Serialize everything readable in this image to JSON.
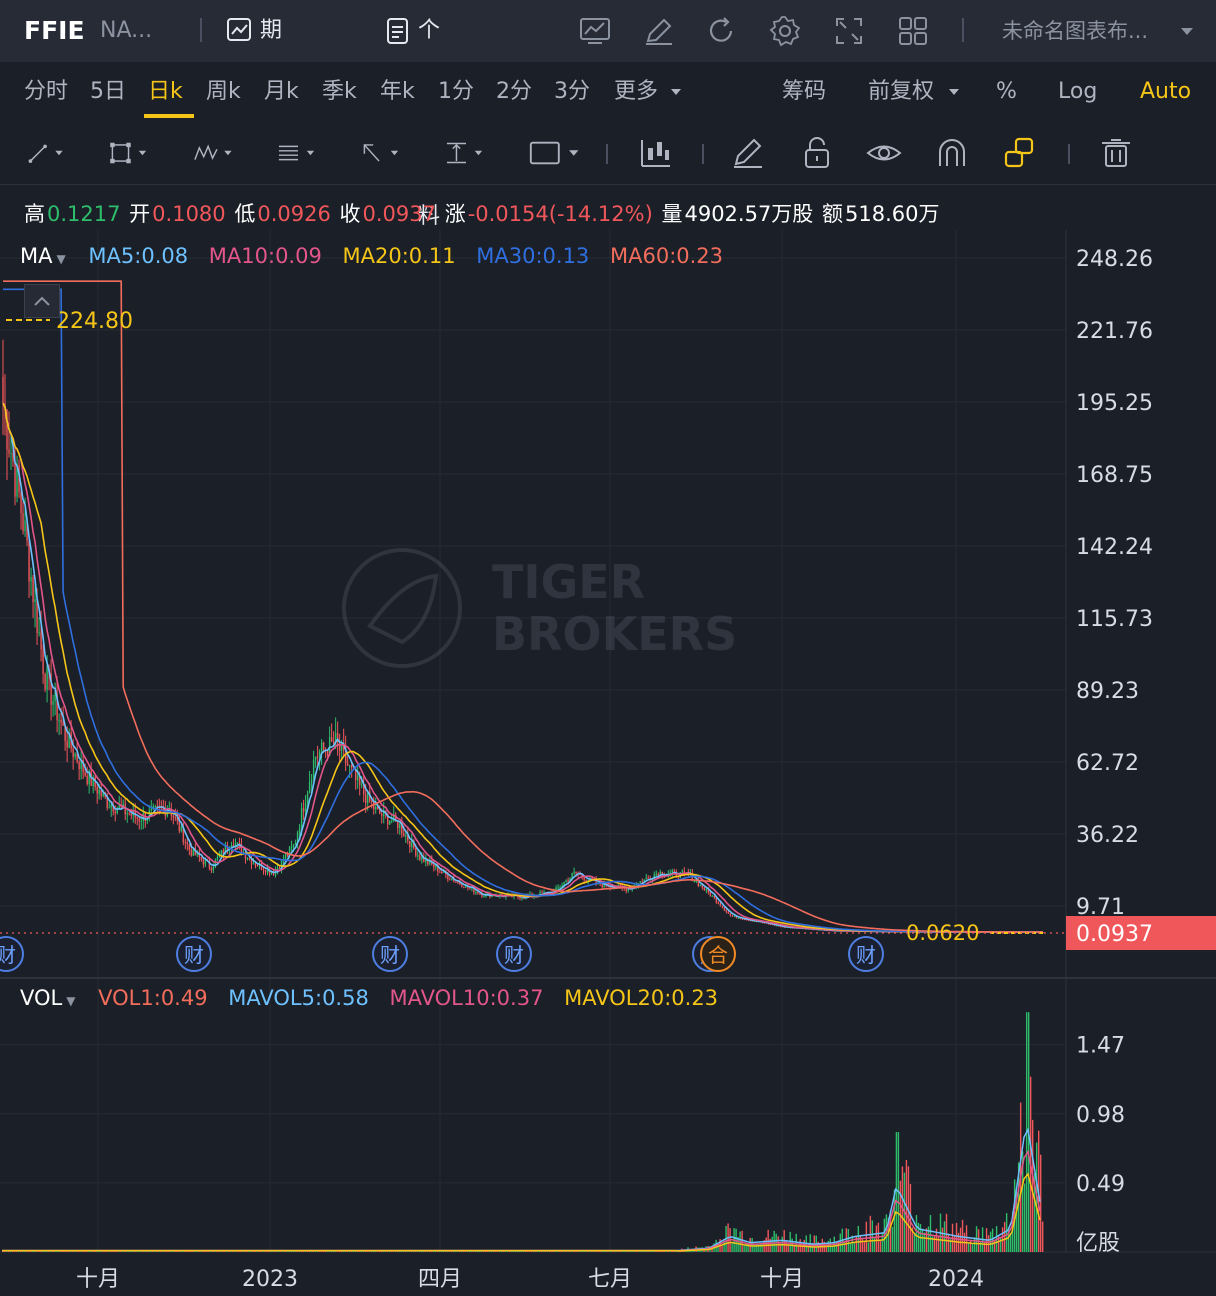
{
  "header": {
    "symbol": "FFIE",
    "name": "NA...",
    "options_chain": "期权链",
    "stock_profile": "个股资料",
    "layout_name": "未命名图表布..."
  },
  "periods": {
    "items": [
      "分时",
      "5日",
      "日k",
      "周k",
      "月k",
      "季k",
      "年k",
      "1分",
      "2分",
      "3分",
      "更多"
    ],
    "active": "日k",
    "chips": "筹码",
    "adjust": "前复权",
    "percent": "%",
    "log": "Log",
    "auto": "Auto"
  },
  "tools": [
    "line-tool-icon",
    "rect-tool-icon",
    "pattern-tool-icon",
    "fib-tool-icon",
    "arrow-tool-icon",
    "measure-tool-icon",
    "text-tool-icon",
    "candle-tool-icon",
    "pencil-icon",
    "unlock-icon",
    "eye-icon",
    "magnet-icon",
    "link-layers-icon",
    "trash-icon"
  ],
  "quote": {
    "high_label": "高",
    "high": "0.1217",
    "open_label": "开",
    "open": "0.1080",
    "low_label": "低",
    "low": "0.0926",
    "close_label": "收",
    "close": "0.0937",
    "change_label": "涨",
    "change": "-0.0154(-14.12%)",
    "volume_label": "量",
    "volume": "4902.57万股",
    "amount_label": "额",
    "amount": "518.60万"
  },
  "ma_legend": {
    "label": "MA",
    "items": [
      {
        "text": "MA5:0.08",
        "color": "#6ec1ff"
      },
      {
        "text": "MA10:0.09",
        "color": "#e3568a"
      },
      {
        "text": "MA20:0.11",
        "color": "#f5c518"
      },
      {
        "text": "MA30:0.13",
        "color": "#2f6fe0"
      },
      {
        "text": "MA60:0.23",
        "color": "#f26d5b"
      }
    ]
  },
  "vol_legend": {
    "label": "VOL",
    "items": [
      {
        "text": "VOL1:0.49",
        "color": "#f26d5b"
      },
      {
        "text": "MAVOL5:0.58",
        "color": "#6ec1ff"
      },
      {
        "text": "MAVOL10:0.37",
        "color": "#e3568a"
      },
      {
        "text": "MAVOL20:0.23",
        "color": "#f5c518"
      }
    ]
  },
  "watermark": {
    "line1": "TIGER",
    "line2": "BROKERS"
  },
  "chart_data": [
    {
      "type": "candlestick",
      "y_ticks": [
        "248.26",
        "221.76",
        "195.25",
        "168.75",
        "142.24",
        "115.73",
        "89.23",
        "62.72",
        "36.22",
        "9.71"
      ],
      "x_ticks": [
        "十月",
        "2023",
        "四月",
        "七月",
        "十月",
        "2024"
      ],
      "max_marker": "224.80",
      "min_marker": "0.0620",
      "last_price": "0.0937",
      "event_markers": [
        "财",
        "财",
        "财",
        "财",
        "财",
        "合",
        "财"
      ],
      "series": [
        {
          "name": "MA5",
          "color": "#6ec1ff",
          "values": [
            0.08
          ]
        },
        {
          "name": "MA10",
          "color": "#e3568a",
          "values": [
            0.09
          ]
        },
        {
          "name": "MA20",
          "color": "#f5c518",
          "values": [
            0.11
          ]
        },
        {
          "name": "MA30",
          "color": "#2f6fe0",
          "values": [
            0.13
          ]
        },
        {
          "name": "MA60",
          "color": "#f26d5b",
          "values": [
            0.23
          ]
        }
      ],
      "close_trend": [
        [
          0,
          195
        ],
        [
          0.02,
          150
        ],
        [
          0.04,
          95
        ],
        [
          0.06,
          72
        ],
        [
          0.08,
          58
        ],
        [
          0.1,
          48
        ],
        [
          0.13,
          42
        ],
        [
          0.16,
          46
        ],
        [
          0.18,
          30
        ],
        [
          0.2,
          24
        ],
        [
          0.22,
          34
        ],
        [
          0.24,
          26
        ],
        [
          0.26,
          22
        ],
        [
          0.28,
          32
        ],
        [
          0.3,
          65
        ],
        [
          0.32,
          70
        ],
        [
          0.34,
          55
        ],
        [
          0.36,
          44
        ],
        [
          0.38,
          40
        ],
        [
          0.4,
          28
        ],
        [
          0.43,
          20
        ],
        [
          0.46,
          14
        ],
        [
          0.5,
          13
        ],
        [
          0.53,
          15
        ],
        [
          0.55,
          22
        ],
        [
          0.57,
          18
        ],
        [
          0.6,
          16
        ],
        [
          0.63,
          22
        ],
        [
          0.66,
          21
        ],
        [
          0.68,
          14
        ],
        [
          0.7,
          6
        ],
        [
          0.75,
          2
        ],
        [
          0.8,
          0.6
        ],
        [
          0.85,
          0.3
        ],
        [
          0.9,
          0.15
        ],
        [
          1,
          0.0937
        ]
      ]
    },
    {
      "type": "bar",
      "name": "VOL",
      "y_ticks": [
        "1.47",
        "0.98",
        "0.49"
      ],
      "unit": "亿股",
      "x_ticks": [
        "十月",
        "2023",
        "四月",
        "七月",
        "十月",
        "2024"
      ],
      "volume_trend": [
        [
          0,
          0.01
        ],
        [
          0.5,
          0.01
        ],
        [
          0.65,
          0.02
        ],
        [
          0.68,
          0.05
        ],
        [
          0.7,
          0.2
        ],
        [
          0.72,
          0.12
        ],
        [
          0.75,
          0.15
        ],
        [
          0.78,
          0.1
        ],
        [
          0.8,
          0.12
        ],
        [
          0.82,
          0.2
        ],
        [
          0.85,
          0.25
        ],
        [
          0.86,
          0.85
        ],
        [
          0.88,
          0.3
        ],
        [
          0.9,
          0.25
        ],
        [
          0.92,
          0.2
        ],
        [
          0.95,
          0.15
        ],
        [
          0.97,
          0.3
        ],
        [
          0.985,
          1.7
        ],
        [
          1,
          0.49
        ]
      ]
    }
  ]
}
